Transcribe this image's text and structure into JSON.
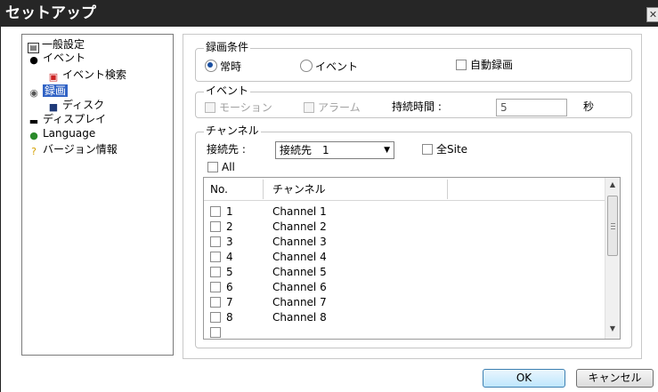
{
  "window": {
    "title": "セットアップ",
    "close_glyph": "✕"
  },
  "tree": [
    {
      "label": "一般設定",
      "icon": "general-settings-icon"
    },
    {
      "label": "イベント",
      "icon": "event-icon"
    },
    {
      "label": "イベント検索",
      "icon": "event-search-icon"
    },
    {
      "label": "録画",
      "icon": "recording-icon",
      "selected": true
    },
    {
      "label": "ディスク",
      "icon": "disk-icon"
    },
    {
      "label": "ディスプレイ",
      "icon": "display-icon"
    },
    {
      "label": "Language",
      "icon": "language-icon"
    },
    {
      "label": "バージョン情報",
      "icon": "version-info-icon"
    }
  ],
  "recording_condition": {
    "title": "録画条件",
    "always": "常時",
    "event": "イベント",
    "selected": "always",
    "auto_record": "自動録画"
  },
  "event": {
    "title": "イベント",
    "motion": "モーション",
    "alarm": "アラーム",
    "duration_label": "持続時間 :",
    "duration_value": "5",
    "unit": "秒"
  },
  "channel": {
    "title": "チャンネル",
    "connect_label": "接続先 :",
    "connect_value": "接続先　1",
    "all_site": "全Site",
    "all": "All",
    "col_no": "No.",
    "col_channel": "チャンネル",
    "rows": [
      {
        "no": "1",
        "name": "Channel 1"
      },
      {
        "no": "2",
        "name": "Channel 2"
      },
      {
        "no": "3",
        "name": "Channel 3"
      },
      {
        "no": "4",
        "name": "Channel 4"
      },
      {
        "no": "5",
        "name": "Channel 5"
      },
      {
        "no": "6",
        "name": "Channel 6"
      },
      {
        "no": "7",
        "name": "Channel 7"
      },
      {
        "no": "8",
        "name": "Channel 8"
      }
    ]
  },
  "buttons": {
    "ok": "OK",
    "cancel": "キャンセル"
  }
}
